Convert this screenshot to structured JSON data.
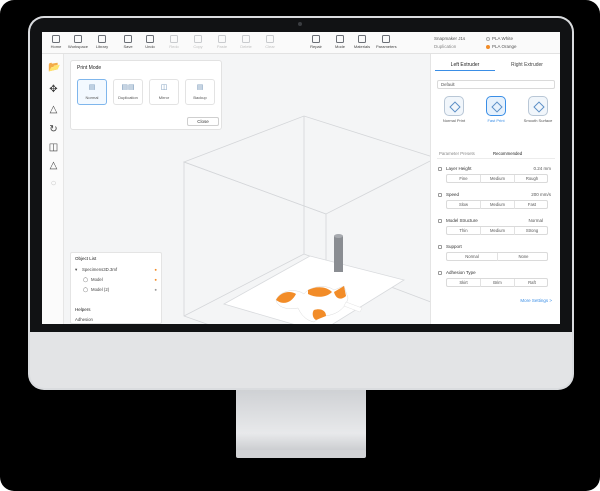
{
  "toolbar": {
    "items": [
      {
        "label": "Home",
        "icon": "home-icon",
        "enabled": true
      },
      {
        "label": "Workspace",
        "icon": "workspace-icon",
        "enabled": true
      },
      {
        "label": "Library",
        "icon": "library-icon",
        "enabled": true
      },
      {
        "label": "Save",
        "icon": "save-icon",
        "enabled": true
      },
      {
        "label": "Undo",
        "icon": "undo-icon",
        "enabled": true
      },
      {
        "label": "Redo",
        "icon": "redo-icon",
        "enabled": false
      },
      {
        "label": "Copy",
        "icon": "copy-icon",
        "enabled": false
      },
      {
        "label": "Paste",
        "icon": "paste-icon",
        "enabled": false
      },
      {
        "label": "Delete",
        "icon": "delete-icon",
        "enabled": false
      },
      {
        "label": "Clear",
        "icon": "clear-icon",
        "enabled": false
      },
      {
        "label": "Repair",
        "icon": "repair-icon",
        "enabled": true
      },
      {
        "label": "Mode",
        "icon": "mode-icon",
        "enabled": true
      },
      {
        "label": "Materials",
        "icon": "materials-icon",
        "enabled": true
      },
      {
        "label": "Parameters",
        "icon": "parameters-icon",
        "enabled": true
      }
    ],
    "printer": {
      "name": "Snapmaker J1s",
      "mode": "Duplication"
    },
    "materials": [
      {
        "label": "PLA White",
        "color": "#ffffff"
      },
      {
        "label": "PLA Orange",
        "color": "#f28c28"
      }
    ]
  },
  "left_tools": [
    "open-file-icon",
    "move-icon",
    "scale-icon",
    "rotate-icon",
    "mirror-icon",
    "support-icon",
    "extra-tool-icon"
  ],
  "print_mode": {
    "title": "Print Mode",
    "options": [
      {
        "label": "Normal",
        "selected": true
      },
      {
        "label": "Duplication",
        "selected": false
      },
      {
        "label": "Mirror",
        "selected": false
      },
      {
        "label": "Backup",
        "selected": false
      }
    ],
    "close_label": "Close"
  },
  "object_list": {
    "title": "Object List",
    "items": [
      {
        "label": "Specimens3D.3mf",
        "level": 0
      },
      {
        "label": "Model",
        "level": 1
      },
      {
        "label": "Model (2)",
        "level": 1
      }
    ],
    "helpers_title": "Helpers",
    "helpers_items": [
      "Adhesion"
    ]
  },
  "right_panel": {
    "tabs": [
      {
        "label": "Left Extruder",
        "active": true
      },
      {
        "label": "Right Extruder",
        "active": false
      }
    ],
    "preset": "Default",
    "profiles": [
      {
        "label": "Normal Print",
        "selected": false
      },
      {
        "label": "Fast Print",
        "selected": true
      },
      {
        "label": "Smooth Surface",
        "selected": false
      }
    ],
    "subtabs": [
      {
        "label": "Parameter Presets",
        "active": false
      },
      {
        "label": "Recommended",
        "active": true
      }
    ],
    "settings": [
      {
        "name": "Layer Height",
        "value": "0.24 mm",
        "options": [
          "Fine",
          "Medium",
          "Rough"
        ]
      },
      {
        "name": "Speed",
        "value": "200 mm/s",
        "options": [
          "Slow",
          "Medium",
          "Fast"
        ]
      },
      {
        "name": "Model Structure",
        "value": "Normal",
        "options": [
          "Thin",
          "Medium",
          "Strong"
        ]
      },
      {
        "name": "Support",
        "value": "",
        "options": [
          "Normal",
          "None"
        ]
      },
      {
        "name": "Adhesion Type",
        "value": "",
        "options": [
          "Skirt",
          "Brim",
          "Raft"
        ]
      }
    ],
    "more_link": "More Settings >"
  },
  "colors": {
    "accent": "#3a8ee6",
    "model_orange": "#f28c28",
    "screen_bg": "#f6f7f8"
  }
}
